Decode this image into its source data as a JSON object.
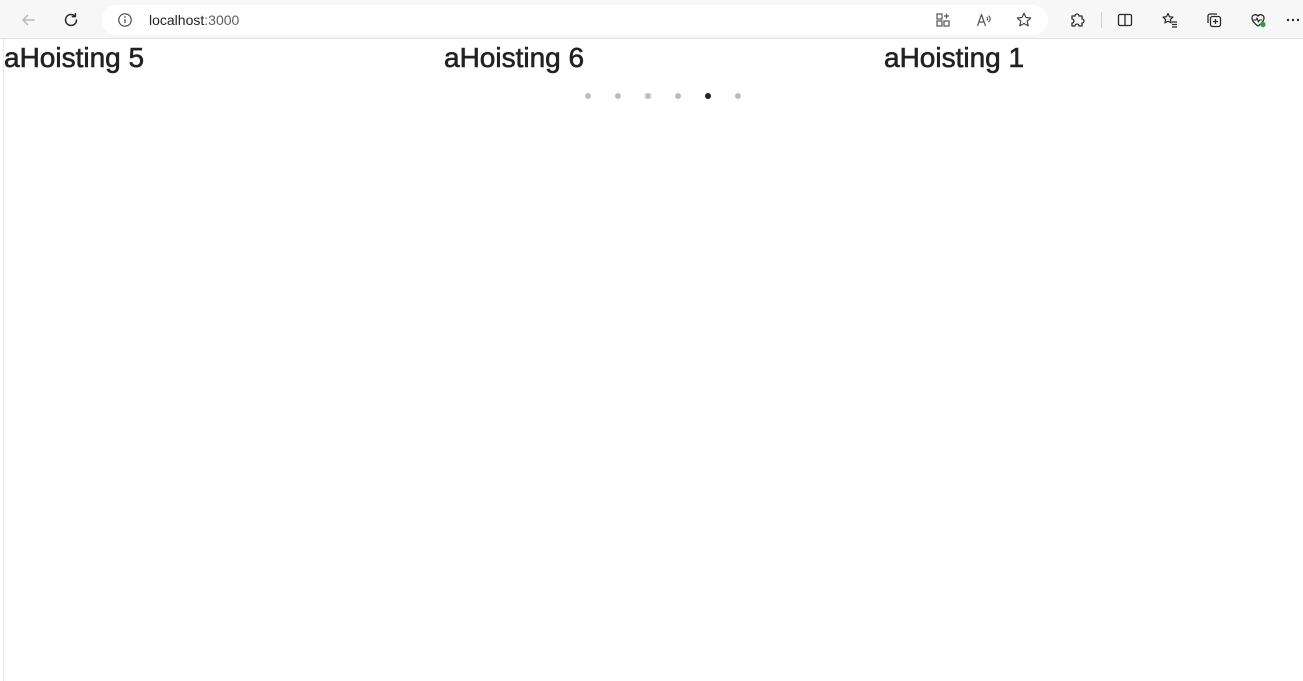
{
  "browser": {
    "url_host": "localhost",
    "url_port": ":3000",
    "icons": {
      "back": "back-arrow-icon",
      "reload": "reload-icon",
      "site_info": "info-icon",
      "app_available": "app-install-icon",
      "read_aloud": "read-aloud-icon",
      "favorite": "star-icon",
      "extensions": "puzzle-icon",
      "split_screen": "split-screen-icon",
      "favorites_bar": "favorites-list-icon",
      "collections": "collections-icon",
      "browser_essentials": "heart-pulse-icon",
      "more": "ellipsis-icon"
    }
  },
  "carousel": {
    "slides": [
      {
        "title": "aHoisting 5"
      },
      {
        "title": "aHoisting 6"
      },
      {
        "title": "aHoisting 1"
      }
    ],
    "dot_count": 6,
    "active_dot_index": 4,
    "colors": {
      "dot": "#bdbdbd",
      "dot_active": "#222222",
      "title": "#222222"
    }
  }
}
